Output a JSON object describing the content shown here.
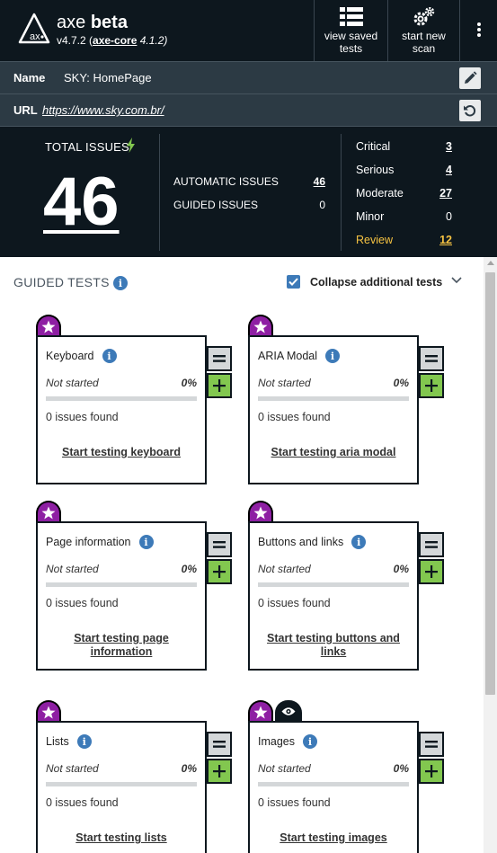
{
  "header": {
    "brand_light": "axe",
    "brand_bold": "beta",
    "version_prefix": "v4.7.2 (",
    "core_link": "axe-core",
    "core_version": " 4.1.2)",
    "saved_tests_label_1": "view saved",
    "saved_tests_label_2": "tests",
    "new_scan_label_1": "start new",
    "new_scan_label_2": "scan"
  },
  "name_row": {
    "label": "Name",
    "value": "SKY: HomePage"
  },
  "url_row": {
    "label": "URL",
    "value": "https://www.sky.com.br/"
  },
  "summary": {
    "total_label": "TOTAL ISSUES",
    "total": "46",
    "automatic_label": "AUTOMATIC ISSUES",
    "automatic": "46",
    "guided_label": "GUIDED ISSUES",
    "guided": "0",
    "impacts": [
      {
        "label": "Critical",
        "value": "3"
      },
      {
        "label": "Serious",
        "value": "4"
      },
      {
        "label": "Moderate",
        "value": "27"
      },
      {
        "label": "Minor",
        "value": "0"
      },
      {
        "label": "Review",
        "value": "12"
      }
    ]
  },
  "guided": {
    "title": "GUIDED TESTS",
    "collapse_label": "Collapse additional tests",
    "collapse_checked": true,
    "cards": [
      {
        "title": "Keyboard",
        "status": "Not started",
        "percent": "0%",
        "progress": 0,
        "found": "0 issues found",
        "link_1": "Start testing keyboard",
        "link_2": ""
      },
      {
        "title": "ARIA Modal",
        "status": "Not started",
        "percent": "0%",
        "progress": 0,
        "found": "0 issues found",
        "link_1": "Start testing aria modal",
        "link_2": ""
      },
      {
        "title": "Page information",
        "status": "Not started",
        "percent": "0%",
        "progress": 0,
        "found": "0 issues found",
        "link_1": "Start testing page",
        "link_2": "information"
      },
      {
        "title": "Buttons and links",
        "status": "Not started",
        "percent": "0%",
        "progress": 0,
        "found": "0 issues found",
        "link_1": "Start testing buttons and",
        "link_2": "links"
      },
      {
        "title": "Lists",
        "status": "Not started",
        "percent": "0%",
        "progress": 0,
        "found": "0 issues found",
        "link_1": "Start testing lists",
        "link_2": ""
      },
      {
        "title": "Images",
        "status": "Not started",
        "percent": "0%",
        "progress": 0,
        "found": "0 issues found",
        "link_1": "Start testing images",
        "link_2": ""
      }
    ]
  },
  "colors": {
    "header_bg": "#0d171e",
    "row_bg": "#2c3a44",
    "star_badge": "#8e1fa3",
    "plus_button": "#82c74f",
    "review": "#f6c342",
    "info_icon": "#3d7ab8"
  },
  "icons": [
    "axe-logo-icon",
    "list-icon",
    "gears-icon",
    "kebab-menu-icon",
    "pencil-icon",
    "refresh-icon",
    "lightning-icon",
    "info-icon",
    "checkbox-icon",
    "chevron-down-icon",
    "star-icon",
    "eye-icon",
    "minus-icon",
    "plus-icon"
  ]
}
